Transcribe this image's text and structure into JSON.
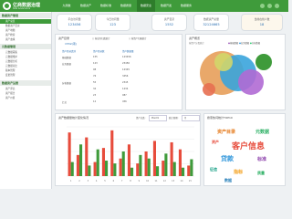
{
  "brand": {
    "name": "亿商数据治理",
    "subtitle": "Data Governance"
  },
  "nav": [
    "九鼎数",
    "数据资产",
    "数据标准",
    "数据质量",
    "数据安全",
    "数据开发",
    "数据服务"
  ],
  "sidebar": {
    "section1": "数据资产管理",
    "items1": [
      "资产总览",
      "数据资产目录",
      "资产地图",
      "资产检索",
      "资产血缘"
    ],
    "section2": "元数据管理",
    "items2": [
      "元数据采集",
      "元数据维护",
      "元数据分析",
      "元数据对比",
      "版本管理",
      "变更管理"
    ],
    "section3": "数据资产运营",
    "items3": [
      "资产评估",
      "资产报告",
      "资产价值"
    ]
  },
  "stats": [
    {
      "label": "平台访问量",
      "value": "123456"
    },
    {
      "label": "今日访问量",
      "value": "123"
    },
    {
      "label": "资产目录",
      "value": "1552"
    },
    {
      "label": "数据资产总量",
      "value": "32124665"
    },
    {
      "label": "当前在线人数",
      "value": "18"
    }
  ],
  "asset_panel": {
    "title": "资产目录",
    "total": "1552(项)",
    "tab1": "○ 按业务归类统计",
    "tab2": "○ 按资产归属统计",
    "headers": [
      "资产目录类别",
      "资产目录数",
      "资产数据量"
    ],
    "rows": [
      [
        "基础数据",
        "155",
        "123456"
      ],
      [
        "业务数据",
        "123",
        "23456"
      ],
      [
        "",
        "98",
        "12345"
      ],
      [
        "",
        "76",
        "3456"
      ],
      [
        "分析数据",
        "55",
        "2345"
      ],
      [
        "",
        "34",
        "1234"
      ],
      [
        "",
        "23",
        "987"
      ],
      [
        "汇总",
        "12",
        "456"
      ]
    ]
  },
  "bubble_panel": {
    "title": "资产概览",
    "subtitle": "按资产分类统计",
    "legend": [
      "基础数据",
      "业务数据",
      "分析数据",
      "其他"
    ]
  },
  "chart_panel": {
    "title": "资产数据量统计变化情况",
    "control1": "资产分类:",
    "control1_value": "Plan01",
    "control2": "统计周期:",
    "control2_value": "月"
  },
  "chart_data": {
    "type": "bar",
    "categories": [
      "1",
      "2",
      "3",
      "4",
      "5",
      "6",
      "7",
      "8",
      "9",
      "10",
      "11",
      "12",
      "13",
      "14",
      "15"
    ],
    "series": [
      {
        "values": [
          62,
          30,
          55,
          20,
          40,
          65,
          25,
          45,
          18,
          35,
          50,
          22,
          48,
          38,
          15
        ]
      },
      {
        "values": [
          20,
          45,
          15,
          38,
          22,
          18,
          35,
          12,
          30,
          25,
          14,
          32,
          20,
          12,
          24
        ]
      }
    ],
    "ylim": [
      0,
      70
    ],
    "grid": true
  },
  "cloud_panel": {
    "title": "搜索热词统计TOP10",
    "words": [
      {
        "text": "资产目录",
        "color": "#e67e22"
      },
      {
        "text": "元数据",
        "color": "#27ae60"
      },
      {
        "text": "客户信息",
        "color": "#e74c3c"
      },
      {
        "text": "资产",
        "color": "#e74c3c"
      },
      {
        "text": "贷款",
        "color": "#3498db"
      },
      {
        "text": "标准",
        "color": "#8e44ad"
      },
      {
        "text": "征信",
        "color": "#16a085"
      },
      {
        "text": "指标",
        "color": "#f39c12"
      },
      {
        "text": "质量",
        "color": "#27ae60"
      },
      {
        "text": "数据",
        "color": "#2980b9"
      }
    ]
  },
  "colors": {
    "primary": "#3f9b3b",
    "bar_red": "#e74c3c",
    "bar_green": "#3f9b3b"
  }
}
